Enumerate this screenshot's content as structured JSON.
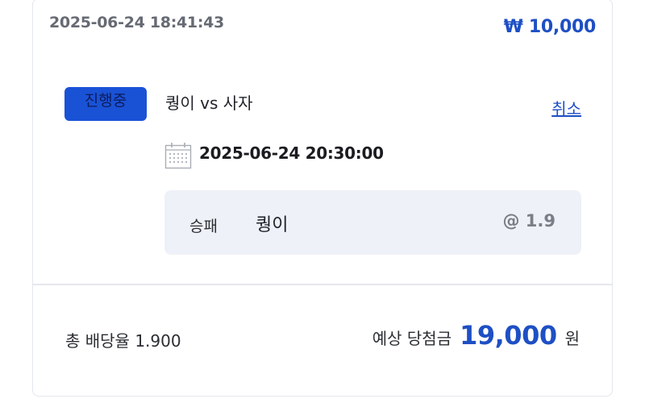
{
  "bet": {
    "timestamp": "2025-06-24 18:41:43",
    "stake": "₩ 10,000",
    "status": "진행중",
    "match": "퀑이 vs 사자",
    "cancel_label": "취소",
    "match_date": "2025-06-24 20:30:00",
    "bet_type": "승패",
    "pick": "퀑이",
    "odds": "@ 1.9"
  },
  "summary": {
    "total_odds": "총 배당율 1.900",
    "payout_label": "예상 당첨금",
    "payout_amount": "19,000",
    "payout_unit": "원"
  },
  "icons": {
    "calendar": "calendar-icon"
  },
  "colors": {
    "accent": "#1e4fc4",
    "badge": "#1a52d6",
    "pick_box": "#eef1f7"
  }
}
